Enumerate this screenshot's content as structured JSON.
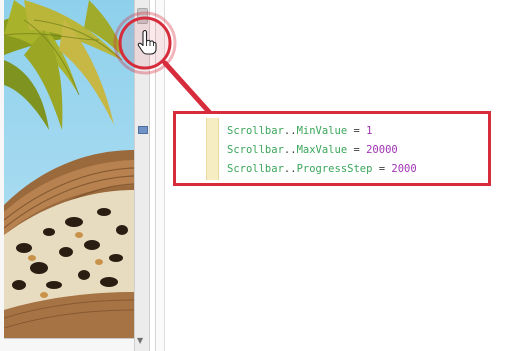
{
  "code": {
    "lines": [
      {
        "object": "Scrollbar",
        "sep": "..",
        "property": "MinValue",
        "op": " = ",
        "value": "1"
      },
      {
        "object": "Scrollbar",
        "sep": "..",
        "property": "MaxValue",
        "op": " = ",
        "value": "20000"
      },
      {
        "object": "Scrollbar",
        "sep": "..",
        "property": "ProgressStep",
        "op": " = ",
        "value": "2000"
      }
    ],
    "colors": {
      "identifier": "#3aa65a",
      "number": "#a133b3",
      "callout": "#d62c3b"
    }
  },
  "icons": {
    "cursor": "hand-pointer-icon",
    "scroll_down": "chevron-down-icon"
  }
}
